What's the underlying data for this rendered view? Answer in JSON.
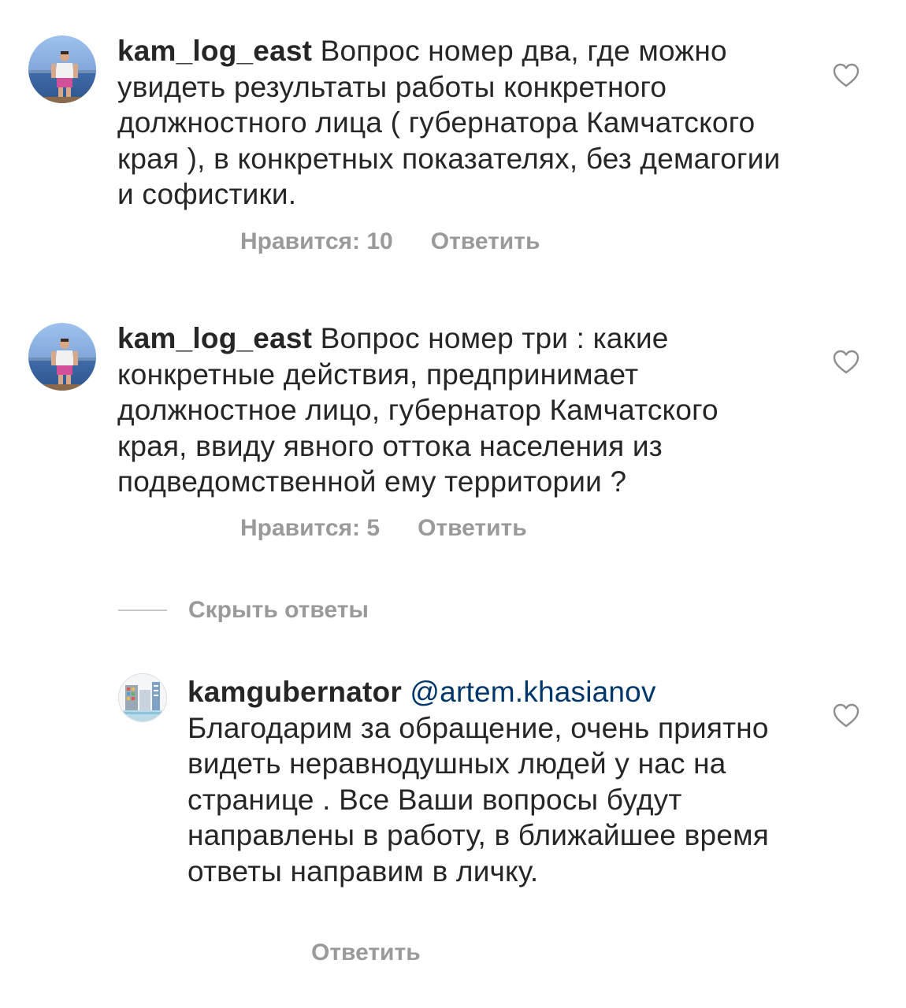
{
  "comments": [
    {
      "username": "kam_log_east",
      "text": " Вопрос номер два, где можно увидеть результаты работы конкретного должностного лица ( губернатора Камчатского края ), в конкретных показателях, без демагогии и софистики.",
      "likes_label": "Нравится: 10",
      "reply_label": "Ответить",
      "avatar_icon": "user-photo-avatar",
      "like_icon": "heart-outline-icon"
    },
    {
      "username": "kam_log_east",
      "text": " Вопрос номер три : какие конкретные действия, предпринимает должностное лицо, губернатор Камчатского края, ввиду явного оттока населения из подведомственной ему территории ?",
      "likes_label": "Нравится: 5",
      "reply_label": "Ответить",
      "avatar_icon": "user-photo-avatar",
      "like_icon": "heart-outline-icon"
    }
  ],
  "hide_replies_label": "Скрыть ответы",
  "reply": {
    "username": "kamgubernator",
    "mention": "@artem.khasianov",
    "text": "Благодарим за обращение, очень приятно видеть неравнодушных людей у нас на странице . Все Ваши вопросы будут направлены в работу, в ближайшее время ответы направим в личку.",
    "reply_label": "Ответить",
    "avatar_icon": "city-illustration-avatar",
    "like_icon": "heart-outline-icon"
  },
  "colors": {
    "text": "#262626",
    "secondary": "#9a9a9a",
    "mention": "#00376b",
    "divider": "#c7c7c7"
  }
}
